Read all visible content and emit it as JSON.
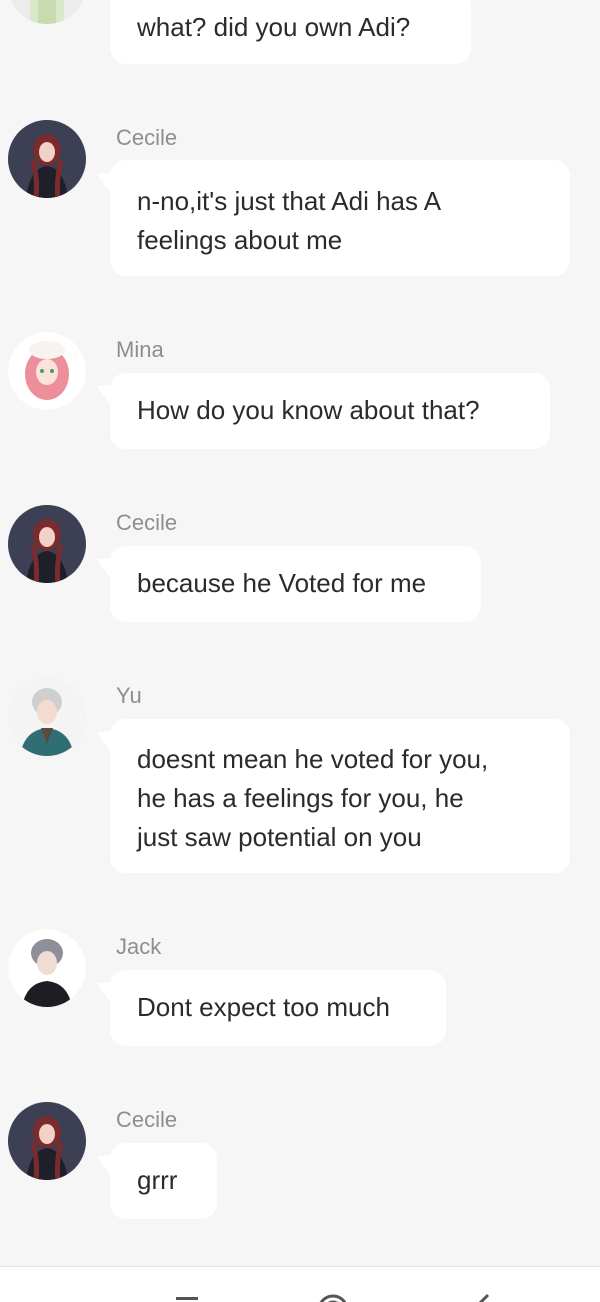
{
  "messages": [
    {
      "sender": "",
      "avatar": "anon-avatar",
      "text": "what? did you own Adi?"
    },
    {
      "sender": "Cecile",
      "avatar": "cecile-avatar",
      "text": "n-no,it's just that Adi has A\nfeelings about me"
    },
    {
      "sender": "Mina",
      "avatar": "mina-avatar",
      "text": "How do you know about that?"
    },
    {
      "sender": "Cecile",
      "avatar": "cecile-avatar",
      "text": "because he Voted for me"
    },
    {
      "sender": "Yu",
      "avatar": "yu-avatar",
      "text": "doesnt mean he voted for you,\nhe has a feelings for you, he\njust saw potential on you"
    },
    {
      "sender": "Jack",
      "avatar": "jack-avatar",
      "text": "Dont expect too much"
    },
    {
      "sender": "Cecile",
      "avatar": "cecile-avatar",
      "text": "grrr"
    }
  ],
  "navbar": {
    "buttons": [
      "recent-apps-icon",
      "home-icon",
      "back-icon"
    ]
  },
  "colors": {
    "background": "#f6f6f6",
    "bubble": "#ffffff",
    "name": "#8e8e8e",
    "text": "#2b2b2b"
  }
}
